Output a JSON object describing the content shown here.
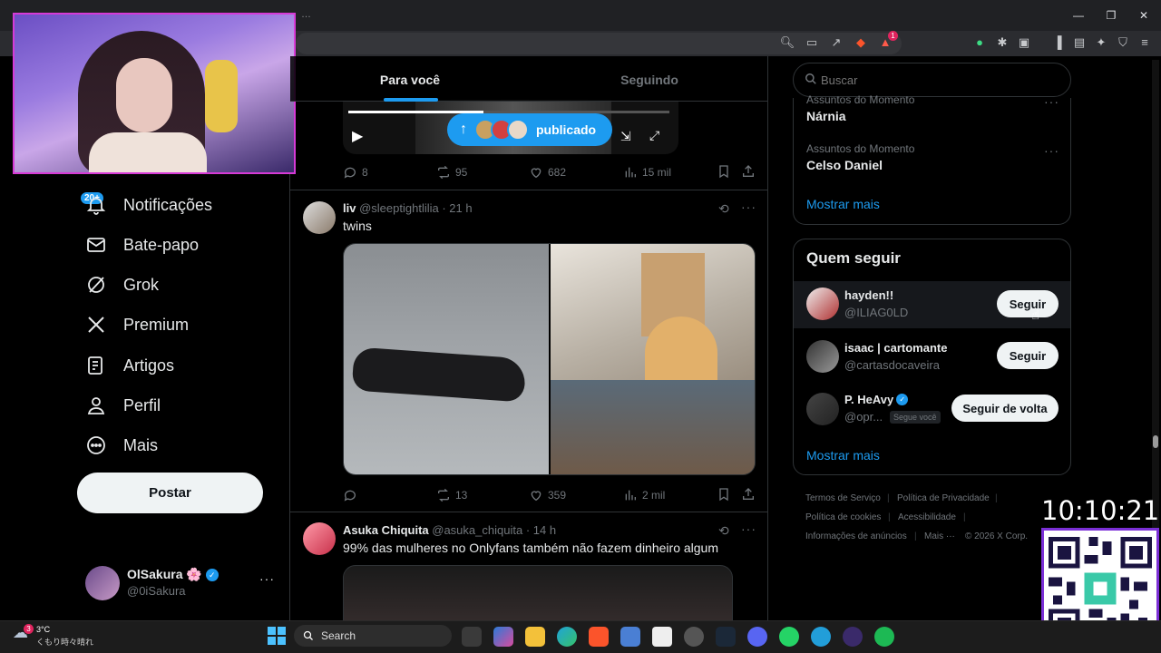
{
  "browser": {
    "tab_title": "…"
  },
  "nav": {
    "notifications_badge": "20+",
    "items": [
      {
        "label": "Notificações",
        "icon": "bell-icon"
      },
      {
        "label": "Bate-papo",
        "icon": "mail-icon"
      },
      {
        "label": "Grok",
        "icon": "grok-icon"
      },
      {
        "label": "Premium",
        "icon": "x-logo-icon"
      },
      {
        "label": "Artigos",
        "icon": "article-icon"
      },
      {
        "label": "Perfil",
        "icon": "person-icon"
      },
      {
        "label": "Mais",
        "icon": "more-circle-icon"
      }
    ],
    "post_button": "Postar"
  },
  "account": {
    "name": "OlSakura 🌸",
    "handle": "@0iSakura"
  },
  "feed": {
    "tabs": [
      "Para você",
      "Seguindo"
    ],
    "active_tab": 0,
    "published_pill": "publicado",
    "tweets": [
      {
        "replies": "8",
        "retweets": "95",
        "likes": "682",
        "views": "15 mil"
      },
      {
        "name": "liv",
        "handle": "@sleeptightlilia",
        "time": "· 21 h",
        "text": "twins",
        "replies": "",
        "retweets": "13",
        "likes": "359",
        "views": "2 mil"
      },
      {
        "name": "Asuka Chiquita",
        "handle": "@asuka_chiquita",
        "time": "· 14 h",
        "text": "99% das mulheres no Onlyfans também não fazem dinheiro algum"
      }
    ]
  },
  "sidebar": {
    "search_placeholder": "Buscar",
    "trends": [
      {
        "category": "Assuntos do Momento",
        "name": "Nárnia"
      },
      {
        "category": "Assuntos do Momento",
        "name": "Celso Daniel"
      }
    ],
    "show_more": "Mostrar mais",
    "who_to_follow": {
      "title": "Quem seguir",
      "accounts": [
        {
          "name": "hayden!!",
          "handle": "@ILIAG0LD",
          "button": "Seguir"
        },
        {
          "name": "isaac | cartomante",
          "handle": "@cartasdocaveira",
          "button": "Seguir"
        },
        {
          "name": "P. HeAvy",
          "handle": "@opr...",
          "badge": "Segue você",
          "button": "Seguir de volta"
        }
      ],
      "show_more": "Mostrar mais"
    },
    "footer": [
      "Termos de Serviço",
      "Política de Privacidade",
      "Política de cookies",
      "Acessibilidade",
      "Informações de anúncios",
      "Mais ···",
      "© 2026 X Corp."
    ]
  },
  "overlay": {
    "clock": "10:10:21"
  },
  "taskbar": {
    "weather_temp": "3°C",
    "weather_desc": "くもり時々晴れ",
    "search_label": "Search"
  },
  "colors": {
    "accent": "#1d9bf0",
    "background": "#000000",
    "border": "#2f3336"
  }
}
